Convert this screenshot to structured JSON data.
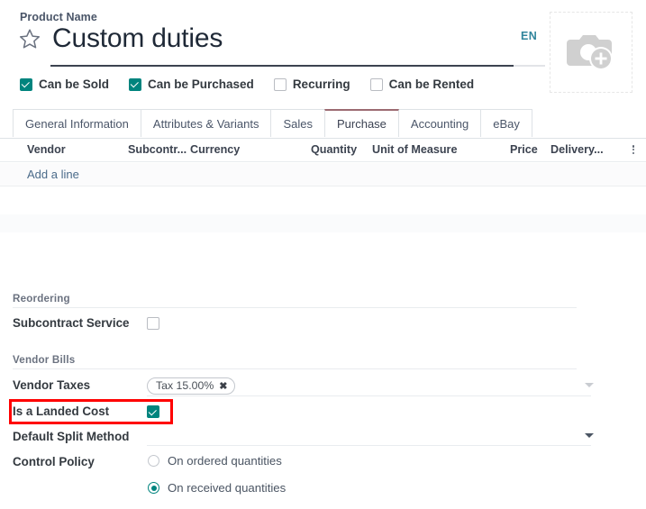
{
  "header": {
    "field_label": "Product Name",
    "product_name": "Custom duties",
    "language": "EN",
    "star_icon": "star-outline-icon",
    "image_placeholder_icon": "camera-add-icon"
  },
  "flags": [
    {
      "label": "Can be Sold",
      "checked": true
    },
    {
      "label": "Can be Purchased",
      "checked": true
    },
    {
      "label": "Recurring",
      "checked": false
    },
    {
      "label": "Can be Rented",
      "checked": false
    }
  ],
  "tabs": [
    {
      "label": "General Information",
      "active": false
    },
    {
      "label": "Attributes & Variants",
      "active": false
    },
    {
      "label": "Sales",
      "active": false
    },
    {
      "label": "Purchase",
      "active": true
    },
    {
      "label": "Accounting",
      "active": false
    },
    {
      "label": "eBay",
      "active": false
    }
  ],
  "table": {
    "columns": [
      {
        "label": "Vendor"
      },
      {
        "label": "Subcontr..."
      },
      {
        "label": "Currency"
      },
      {
        "label": "Quantity"
      },
      {
        "label": "Unit of Measure"
      },
      {
        "label": "Price"
      },
      {
        "label": "Delivery..."
      }
    ],
    "options_icon": "vertical-dots-icon",
    "add_line_label": "Add a line",
    "rows": []
  },
  "sections": [
    {
      "title": "Reordering"
    },
    {
      "title": "Vendor Bills"
    }
  ],
  "fields": {
    "subcontract_service": {
      "label": "Subcontract Service",
      "checked": false
    },
    "vendor_taxes": {
      "label": "Vendor Taxes",
      "tag": "Tax 15.00%",
      "tag_remove_icon": "close-x-icon",
      "caret_icon": "chevron-down-icon"
    },
    "is_landed_cost": {
      "label": "Is a Landed Cost",
      "checked": true,
      "highlighted": true
    },
    "default_split_method": {
      "label": "Default Split Method",
      "value": "",
      "caret_icon": "chevron-down-icon"
    },
    "control_policy": {
      "label": "Control Policy",
      "options": [
        {
          "label": "On ordered quantities",
          "selected": false
        },
        {
          "label": "On received quantities",
          "selected": true
        }
      ]
    }
  },
  "colors": {
    "accent_teal": "#00847e",
    "active_tab_border": "#9c6b72",
    "link_blue": "#4b6b8a",
    "lang_badge": "#31859c",
    "highlight_red": "#ff0000"
  }
}
